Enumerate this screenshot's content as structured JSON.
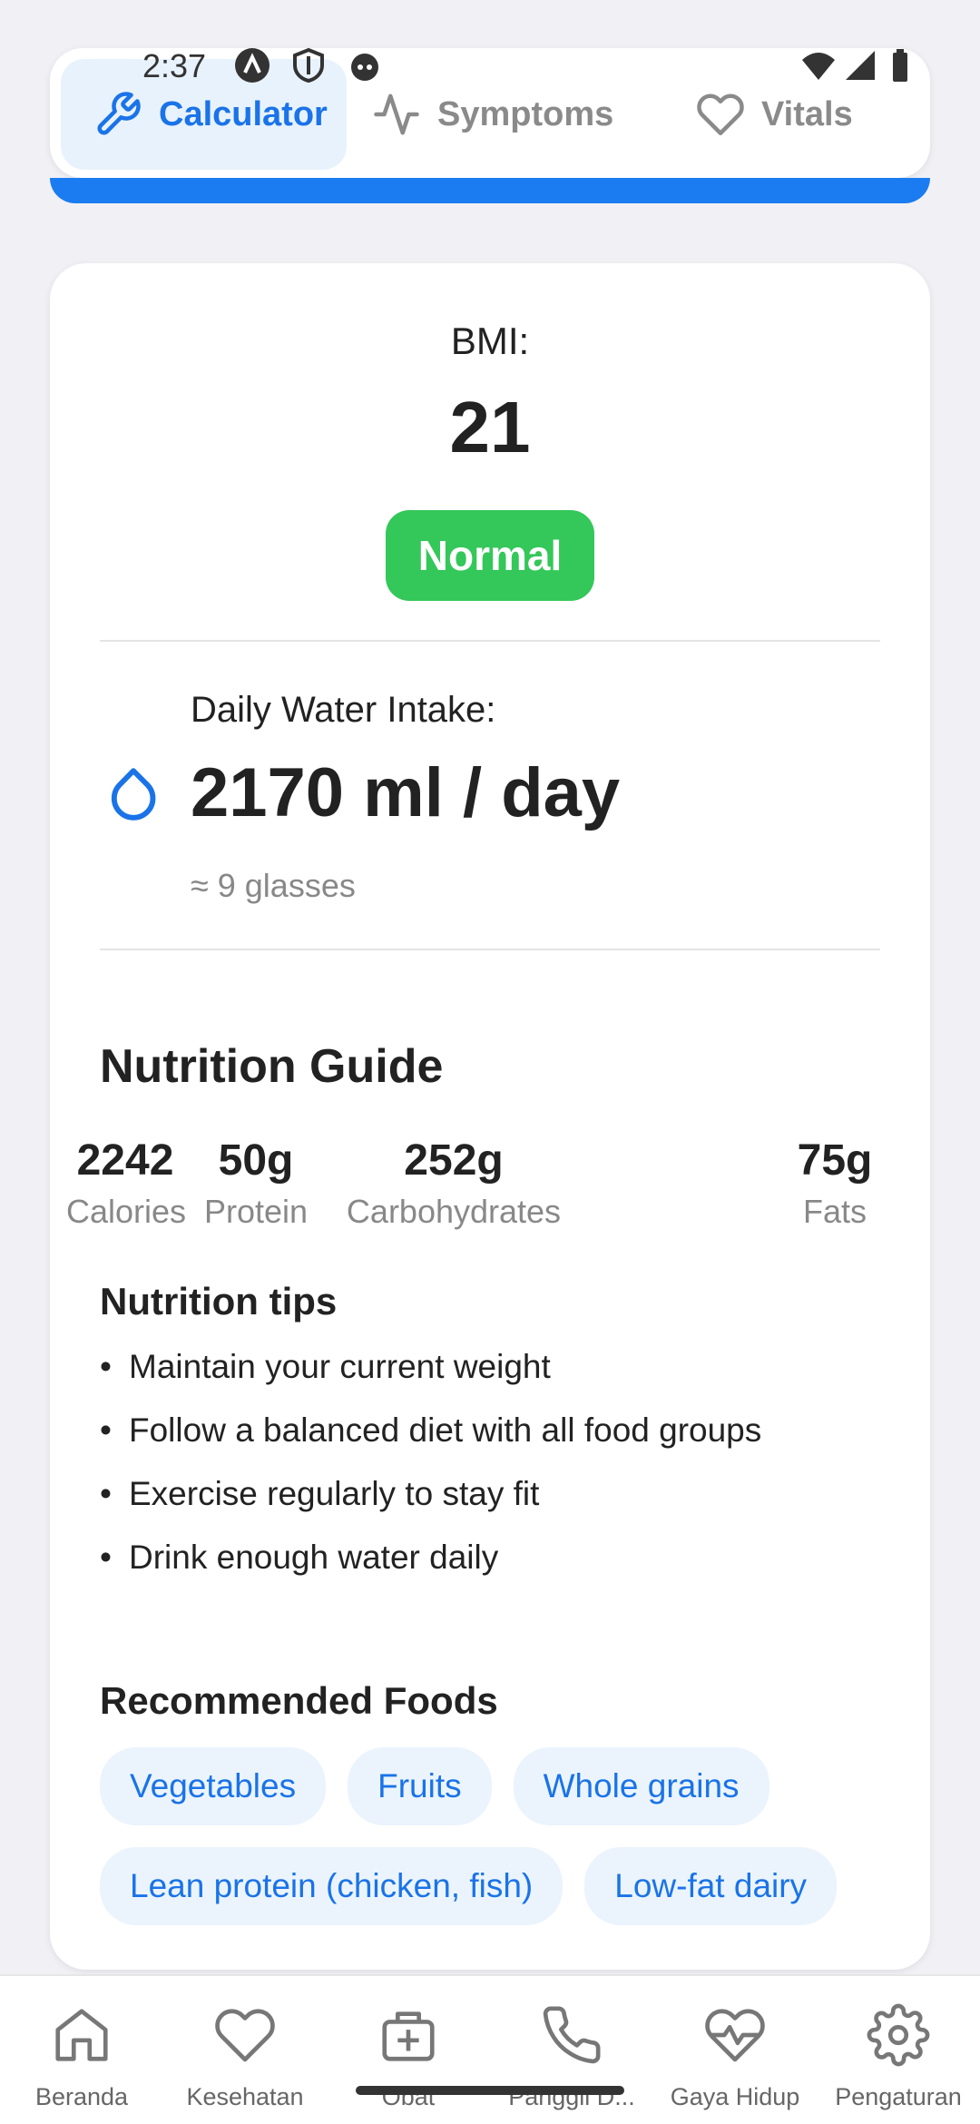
{
  "status_bar": {
    "time": "2:37"
  },
  "tabs": [
    {
      "label": "Calculator",
      "icon": "wrench-icon",
      "active": true
    },
    {
      "label": "Symptoms",
      "icon": "pulse-icon",
      "active": false
    },
    {
      "label": "Vitals",
      "icon": "heart-icon",
      "active": false
    }
  ],
  "bmi": {
    "label": "BMI:",
    "value": "21",
    "status": "Normal"
  },
  "water": {
    "label": "Daily Water Intake:",
    "value": "2170 ml / day",
    "glasses": "≈ 9 glasses",
    "icon": "water-drop-icon"
  },
  "nutrition": {
    "title": "Nutrition Guide",
    "macros": [
      {
        "value": "2242",
        "label": "Calories"
      },
      {
        "value": "50g",
        "label": "Protein"
      },
      {
        "value": "252g",
        "label": "Carbohydrates"
      },
      {
        "value": "75g",
        "label": "Fats"
      }
    ],
    "tips_title": "Nutrition tips",
    "tips": [
      "Maintain your current weight",
      "Follow a balanced diet with all food groups",
      "Exercise regularly to stay fit",
      "Drink enough water daily"
    ],
    "foods_title": "Recommended Foods",
    "foods": [
      "Vegetables",
      "Fruits",
      "Whole grains",
      "Lean protein (chicken, fish)",
      "Low-fat dairy"
    ]
  },
  "bottom_nav": [
    {
      "label": "Beranda",
      "icon": "home-icon"
    },
    {
      "label": "Kesehatan",
      "icon": "heart-icon"
    },
    {
      "label": "Obat",
      "icon": "medkit-icon"
    },
    {
      "label": "Panggil D...",
      "icon": "phone-icon"
    },
    {
      "label": "Gaya Hidup",
      "icon": "heart-pulse-icon"
    },
    {
      "label": "Pengaturan",
      "icon": "gear-icon"
    }
  ],
  "colors": {
    "accent": "#1a73e8",
    "bar": "#1a7cf0",
    "badge": "#34c759",
    "chip_bg": "#ebf4fd",
    "background": "#f0f0f5"
  }
}
